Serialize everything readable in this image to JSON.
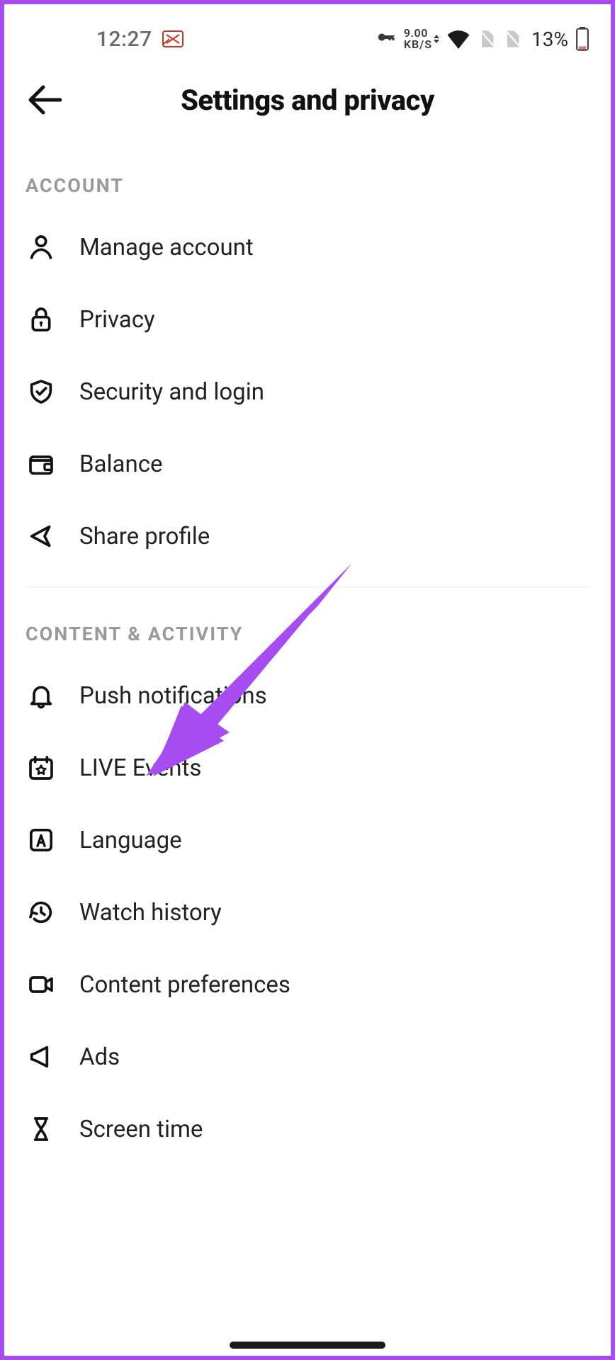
{
  "status": {
    "time": "12:27",
    "net_speed_top": "9.00",
    "net_speed_bot": "KB/S",
    "battery_pct": "13%"
  },
  "header": {
    "title": "Settings and privacy"
  },
  "sections": {
    "account": {
      "title": "ACCOUNT",
      "items": [
        {
          "label": "Manage account"
        },
        {
          "label": "Privacy"
        },
        {
          "label": "Security and login"
        },
        {
          "label": "Balance"
        },
        {
          "label": "Share profile"
        }
      ]
    },
    "content": {
      "title": "CONTENT & ACTIVITY",
      "items": [
        {
          "label": "Push notifications"
        },
        {
          "label": "LIVE Events"
        },
        {
          "label": "Language"
        },
        {
          "label": "Watch history"
        },
        {
          "label": "Content preferences"
        },
        {
          "label": "Ads"
        },
        {
          "label": "Screen time"
        }
      ]
    }
  }
}
